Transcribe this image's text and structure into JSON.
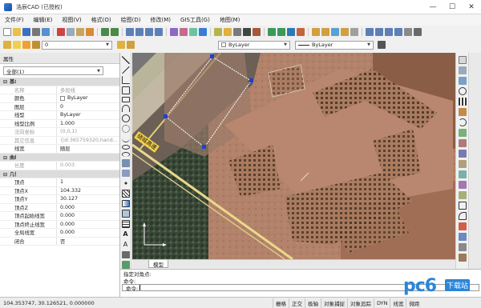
{
  "window": {
    "title": "浩辰CAD (已授权)",
    "minimize": "—",
    "maximize": "☐",
    "close": "✕"
  },
  "menu": [
    "文件(F)",
    "编辑(E)",
    "视图(V)",
    "格式(O)",
    "绘图(D)",
    "修改(M)",
    "GIS工具(G)",
    "地图(M)"
  ],
  "toolbar2": {
    "layer_value": "0",
    "color_value": "ByLayer",
    "linetype_value": "ByLayer"
  },
  "props": {
    "header": "属性",
    "selector": "全部(1)",
    "rows": [
      {
        "type": "section",
        "label": "基本"
      },
      {
        "k": "名称",
        "v": "多段线",
        "grey": true
      },
      {
        "k": "颜色",
        "v": "ByLayer",
        "swatch": true
      },
      {
        "k": "图层",
        "v": "0"
      },
      {
        "k": "线型",
        "v": "ByLayer"
      },
      {
        "k": "线型比例",
        "v": "1.000"
      },
      {
        "k": "法向坐标",
        "v": "(0,0,1)",
        "grey": true
      },
      {
        "k": "其它信息",
        "v": "{id:365759320,hand…",
        "grey": true
      },
      {
        "k": "线宽",
        "v": "随层"
      },
      {
        "type": "section",
        "label": "曲线参数"
      },
      {
        "k": "长度",
        "v": "0.003",
        "grey": true
      },
      {
        "type": "section",
        "label": "几何图形"
      },
      {
        "k": "顶点",
        "v": "1"
      },
      {
        "k": "顶点X",
        "v": "104.332"
      },
      {
        "k": "顶点Y",
        "v": "30.127"
      },
      {
        "k": "顶点Z",
        "v": "0.000"
      },
      {
        "k": "顶点起始线宽",
        "v": "0.000"
      },
      {
        "k": "顶点终止线宽",
        "v": "0.000"
      },
      {
        "k": "全局线宽",
        "v": "0.000"
      },
      {
        "k": "闭合",
        "v": "否"
      }
    ]
  },
  "canvas": {
    "road_label": "绕城高速"
  },
  "layout_tab": "模型",
  "command": {
    "line1": "指定对角点:",
    "line2": "命令:",
    "prompt": "命令:"
  },
  "status": {
    "coords": "104.353747, 30.126521, 0.000000",
    "buttons": [
      "栅格",
      "正交",
      "极轴",
      "对象捕捉",
      "对象追踪",
      "DYN",
      "线宽",
      "微距"
    ]
  },
  "watermark": {
    "brand": "pc6",
    "sub": "下载站"
  },
  "colors": {
    "title_bg": "#ffffff",
    "selection": "#1f3fd6",
    "accent": "#3a7bd5"
  }
}
